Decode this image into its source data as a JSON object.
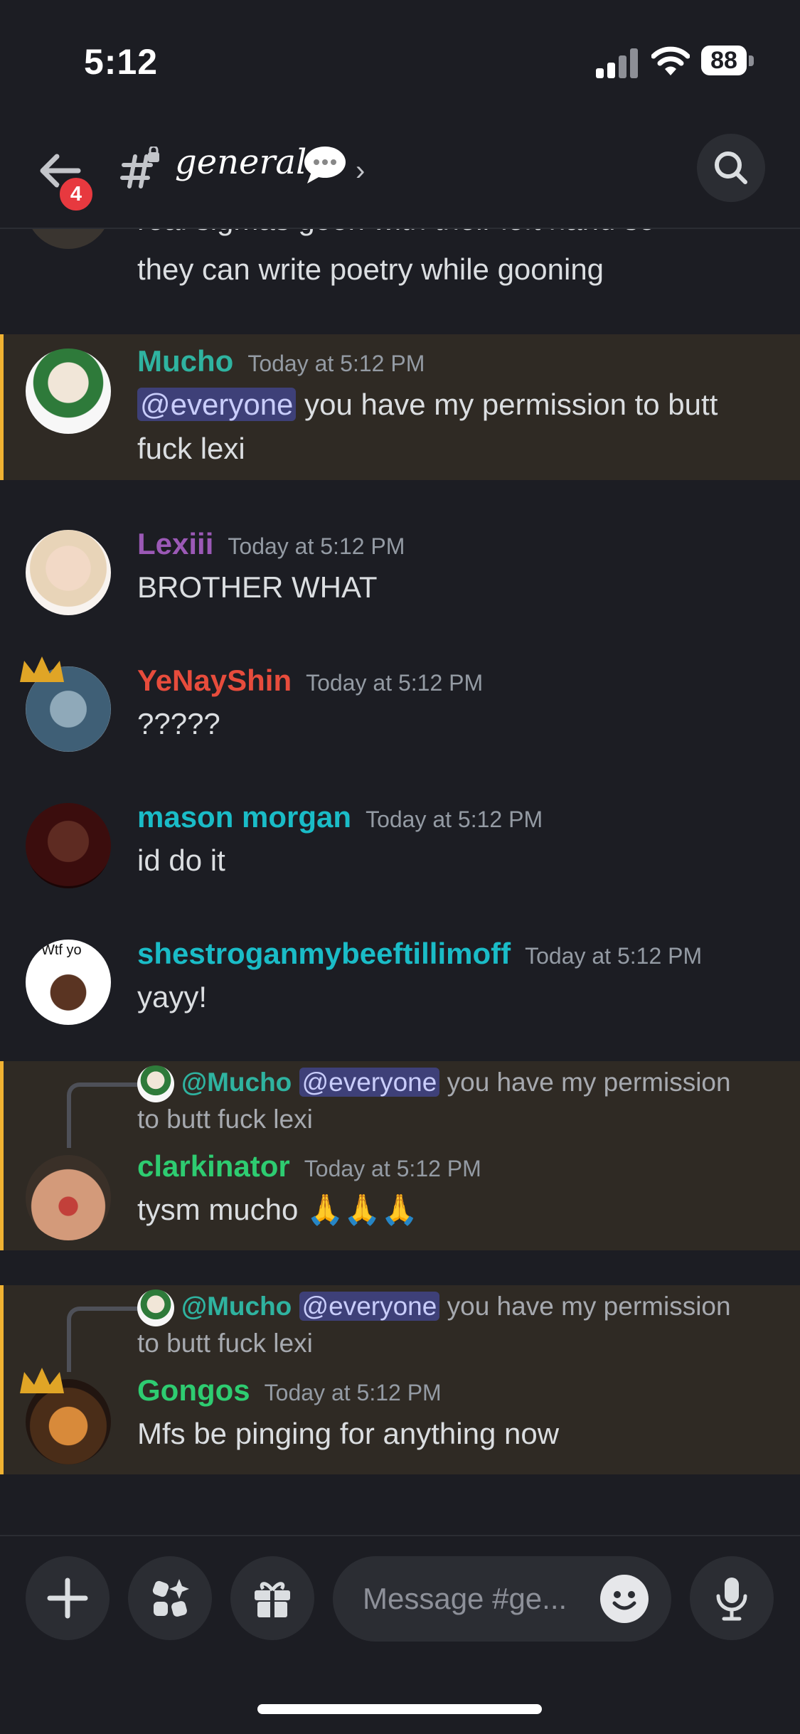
{
  "status": {
    "time": "5:12",
    "battery": "88"
  },
  "header": {
    "channel": "general",
    "notification_count": "4"
  },
  "partial_message": {
    "line1": "real sigmas goon with their left hand so",
    "line2": "they can write poetry while gooning"
  },
  "messages": [
    {
      "name": "Mucho",
      "color": "#2fb3a0",
      "time": "Today at 5:12 PM",
      "mention": "@everyone",
      "line1": " you have my permission to butt",
      "line2": "fuck lexi"
    },
    {
      "name": "Lexiii",
      "color": "#9b59b6",
      "time": "Today at 5:12 PM",
      "text": "BROTHER WHAT"
    },
    {
      "name": "YeNayShin",
      "color": "#e74c3c",
      "time": "Today at 5:12 PM",
      "text": "?????"
    },
    {
      "name": "mason morgan",
      "color": "#1abcc7",
      "time": "Today at 5:12 PM",
      "text": "id do it"
    },
    {
      "name": "shestroganmybeeftillimoff",
      "color": "#1abcc7",
      "time": "Today at 5:12 PM",
      "text": "yayy!",
      "avatar_text": "Wtf yo"
    },
    {
      "name": "clarkinator",
      "color": "#2ecc71",
      "time": "Today at 5:12 PM",
      "text": "tysm mucho 🙏🙏🙏",
      "reply": {
        "name": "@Mucho",
        "mention": "@everyone",
        "line1": " you have my permission",
        "line2": "to butt fuck lexi"
      }
    },
    {
      "name": "Gongos",
      "color": "#2ecc71",
      "time": "Today at 5:12 PM",
      "text": "Mfs be pinging for anything now",
      "reply": {
        "name": "@Mucho",
        "mention": "@everyone",
        "line1": " you have my permission",
        "line2": "to butt fuck lexi"
      }
    }
  ],
  "composer": {
    "placeholder": "Message #ge..."
  }
}
